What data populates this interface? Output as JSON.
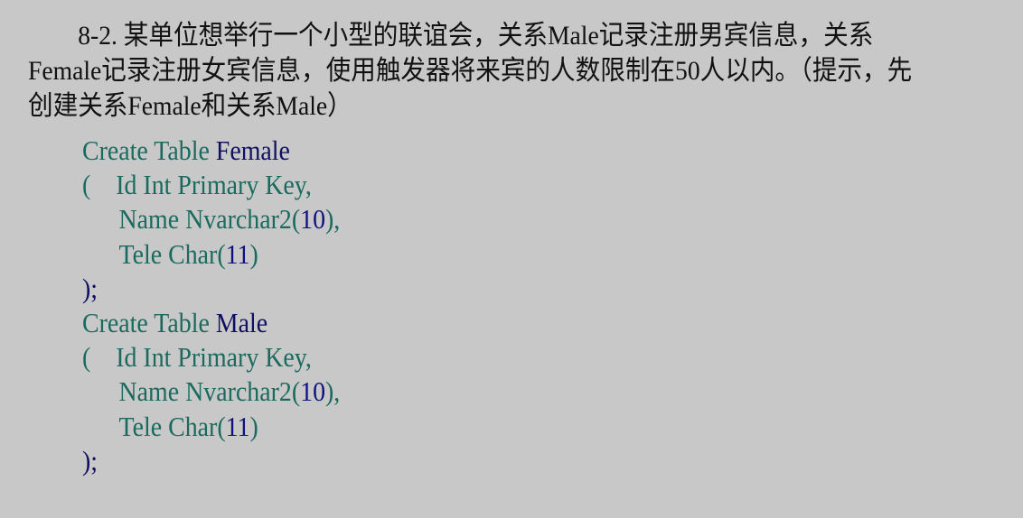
{
  "problem": {
    "lines": [
      "8-2. 某单位想举行一个小型的联谊会，关系Male记录注册男宾信息，关系",
      "Female记录注册女宾信息，使用触发器将来宾的人数限制在50人以内。（提示，先",
      "创建关系Female和关系Male）"
    ]
  },
  "code": {
    "female": {
      "kw_create": "Create Table",
      "table_name": "Female",
      "open_paren": "(",
      "col1": "Id Int Primary Key,",
      "col2_kw": "Name Nvarchar2(",
      "col2_len": "10",
      "col2_end": "),",
      "col3_kw": "Tele Char(",
      "col3_len": "11",
      "col3_end": ")",
      "close": ");"
    },
    "male": {
      "kw_create": "Create Table",
      "table_name": "Male",
      "open_paren": "(",
      "col1": "Id Int Primary Key,",
      "col2_kw": "Name Nvarchar2(",
      "col2_len": "10",
      "col2_end": "),",
      "col3_kw": "Tele Char(",
      "col3_len": "11",
      "col3_end": ")",
      "close": ");"
    }
  },
  "colors": {
    "background": "#c8c8c8",
    "text": "#111111",
    "keyword": "#1a6a5e",
    "identifier": "#101060",
    "number": "#101080"
  }
}
